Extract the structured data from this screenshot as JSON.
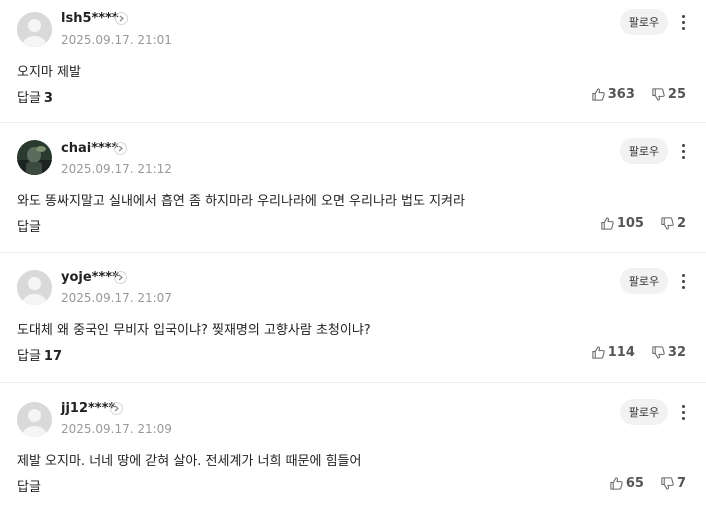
{
  "follow_label": "팔로우",
  "reply_label": "답글",
  "comments": [
    {
      "username": "lsh5****",
      "datetime": "2025.09.17. 21:01",
      "text": "오지마 제발",
      "reply_count": "3",
      "likes": "363",
      "dislikes": "25",
      "avatar": "default"
    },
    {
      "username": "chai****",
      "datetime": "2025.09.17. 21:12",
      "text": "와도 똥싸지말고 실내에서 흡연 좀 하지마라 우리나라에 오면 우리나라 법도 지켜라",
      "reply_count": "",
      "likes": "105",
      "dislikes": "2",
      "avatar": "photo"
    },
    {
      "username": "yoje****",
      "datetime": "2025.09.17. 21:07",
      "text": "도대체 왜 중국인 무비자 입국이냐? 찢재명의 고향사람 초청이냐?",
      "reply_count": "17",
      "likes": "114",
      "dislikes": "32",
      "avatar": "default"
    },
    {
      "username": "jj12****",
      "datetime": "2025.09.17. 21:09",
      "text": "제발 오지마. 너네 땅에 갇혀 살아. 전세계가 너희 때문에 힘들어",
      "reply_count": "",
      "likes": "65",
      "dislikes": "7",
      "avatar": "default"
    }
  ]
}
